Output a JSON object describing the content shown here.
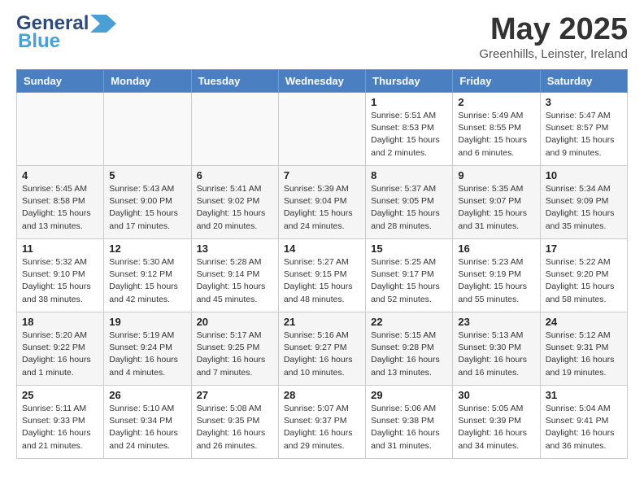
{
  "header": {
    "logo_line1": "General",
    "logo_line2": "Blue",
    "main_title": "May 2025",
    "sub_title": "Greenhills, Leinster, Ireland"
  },
  "days_of_week": [
    "Sunday",
    "Monday",
    "Tuesday",
    "Wednesday",
    "Thursday",
    "Friday",
    "Saturday"
  ],
  "weeks": [
    [
      {
        "day": "",
        "empty": true
      },
      {
        "day": "",
        "empty": true
      },
      {
        "day": "",
        "empty": true
      },
      {
        "day": "",
        "empty": true
      },
      {
        "day": "1",
        "sunrise": "5:51 AM",
        "sunset": "8:53 PM",
        "daylight": "15 hours and 2 minutes."
      },
      {
        "day": "2",
        "sunrise": "5:49 AM",
        "sunset": "8:55 PM",
        "daylight": "15 hours and 6 minutes."
      },
      {
        "day": "3",
        "sunrise": "5:47 AM",
        "sunset": "8:57 PM",
        "daylight": "15 hours and 9 minutes."
      }
    ],
    [
      {
        "day": "4",
        "sunrise": "5:45 AM",
        "sunset": "8:58 PM",
        "daylight": "15 hours and 13 minutes."
      },
      {
        "day": "5",
        "sunrise": "5:43 AM",
        "sunset": "9:00 PM",
        "daylight": "15 hours and 17 minutes."
      },
      {
        "day": "6",
        "sunrise": "5:41 AM",
        "sunset": "9:02 PM",
        "daylight": "15 hours and 20 minutes."
      },
      {
        "day": "7",
        "sunrise": "5:39 AM",
        "sunset": "9:04 PM",
        "daylight": "15 hours and 24 minutes."
      },
      {
        "day": "8",
        "sunrise": "5:37 AM",
        "sunset": "9:05 PM",
        "daylight": "15 hours and 28 minutes."
      },
      {
        "day": "9",
        "sunrise": "5:35 AM",
        "sunset": "9:07 PM",
        "daylight": "15 hours and 31 minutes."
      },
      {
        "day": "10",
        "sunrise": "5:34 AM",
        "sunset": "9:09 PM",
        "daylight": "15 hours and 35 minutes."
      }
    ],
    [
      {
        "day": "11",
        "sunrise": "5:32 AM",
        "sunset": "9:10 PM",
        "daylight": "15 hours and 38 minutes."
      },
      {
        "day": "12",
        "sunrise": "5:30 AM",
        "sunset": "9:12 PM",
        "daylight": "15 hours and 42 minutes."
      },
      {
        "day": "13",
        "sunrise": "5:28 AM",
        "sunset": "9:14 PM",
        "daylight": "15 hours and 45 minutes."
      },
      {
        "day": "14",
        "sunrise": "5:27 AM",
        "sunset": "9:15 PM",
        "daylight": "15 hours and 48 minutes."
      },
      {
        "day": "15",
        "sunrise": "5:25 AM",
        "sunset": "9:17 PM",
        "daylight": "15 hours and 52 minutes."
      },
      {
        "day": "16",
        "sunrise": "5:23 AM",
        "sunset": "9:19 PM",
        "daylight": "15 hours and 55 minutes."
      },
      {
        "day": "17",
        "sunrise": "5:22 AM",
        "sunset": "9:20 PM",
        "daylight": "15 hours and 58 minutes."
      }
    ],
    [
      {
        "day": "18",
        "sunrise": "5:20 AM",
        "sunset": "9:22 PM",
        "daylight": "16 hours and 1 minute."
      },
      {
        "day": "19",
        "sunrise": "5:19 AM",
        "sunset": "9:24 PM",
        "daylight": "16 hours and 4 minutes."
      },
      {
        "day": "20",
        "sunrise": "5:17 AM",
        "sunset": "9:25 PM",
        "daylight": "16 hours and 7 minutes."
      },
      {
        "day": "21",
        "sunrise": "5:16 AM",
        "sunset": "9:27 PM",
        "daylight": "16 hours and 10 minutes."
      },
      {
        "day": "22",
        "sunrise": "5:15 AM",
        "sunset": "9:28 PM",
        "daylight": "16 hours and 13 minutes."
      },
      {
        "day": "23",
        "sunrise": "5:13 AM",
        "sunset": "9:30 PM",
        "daylight": "16 hours and 16 minutes."
      },
      {
        "day": "24",
        "sunrise": "5:12 AM",
        "sunset": "9:31 PM",
        "daylight": "16 hours and 19 minutes."
      }
    ],
    [
      {
        "day": "25",
        "sunrise": "5:11 AM",
        "sunset": "9:33 PM",
        "daylight": "16 hours and 21 minutes."
      },
      {
        "day": "26",
        "sunrise": "5:10 AM",
        "sunset": "9:34 PM",
        "daylight": "16 hours and 24 minutes."
      },
      {
        "day": "27",
        "sunrise": "5:08 AM",
        "sunset": "9:35 PM",
        "daylight": "16 hours and 26 minutes."
      },
      {
        "day": "28",
        "sunrise": "5:07 AM",
        "sunset": "9:37 PM",
        "daylight": "16 hours and 29 minutes."
      },
      {
        "day": "29",
        "sunrise": "5:06 AM",
        "sunset": "9:38 PM",
        "daylight": "16 hours and 31 minutes."
      },
      {
        "day": "30",
        "sunrise": "5:05 AM",
        "sunset": "9:39 PM",
        "daylight": "16 hours and 34 minutes."
      },
      {
        "day": "31",
        "sunrise": "5:04 AM",
        "sunset": "9:41 PM",
        "daylight": "16 hours and 36 minutes."
      }
    ]
  ]
}
